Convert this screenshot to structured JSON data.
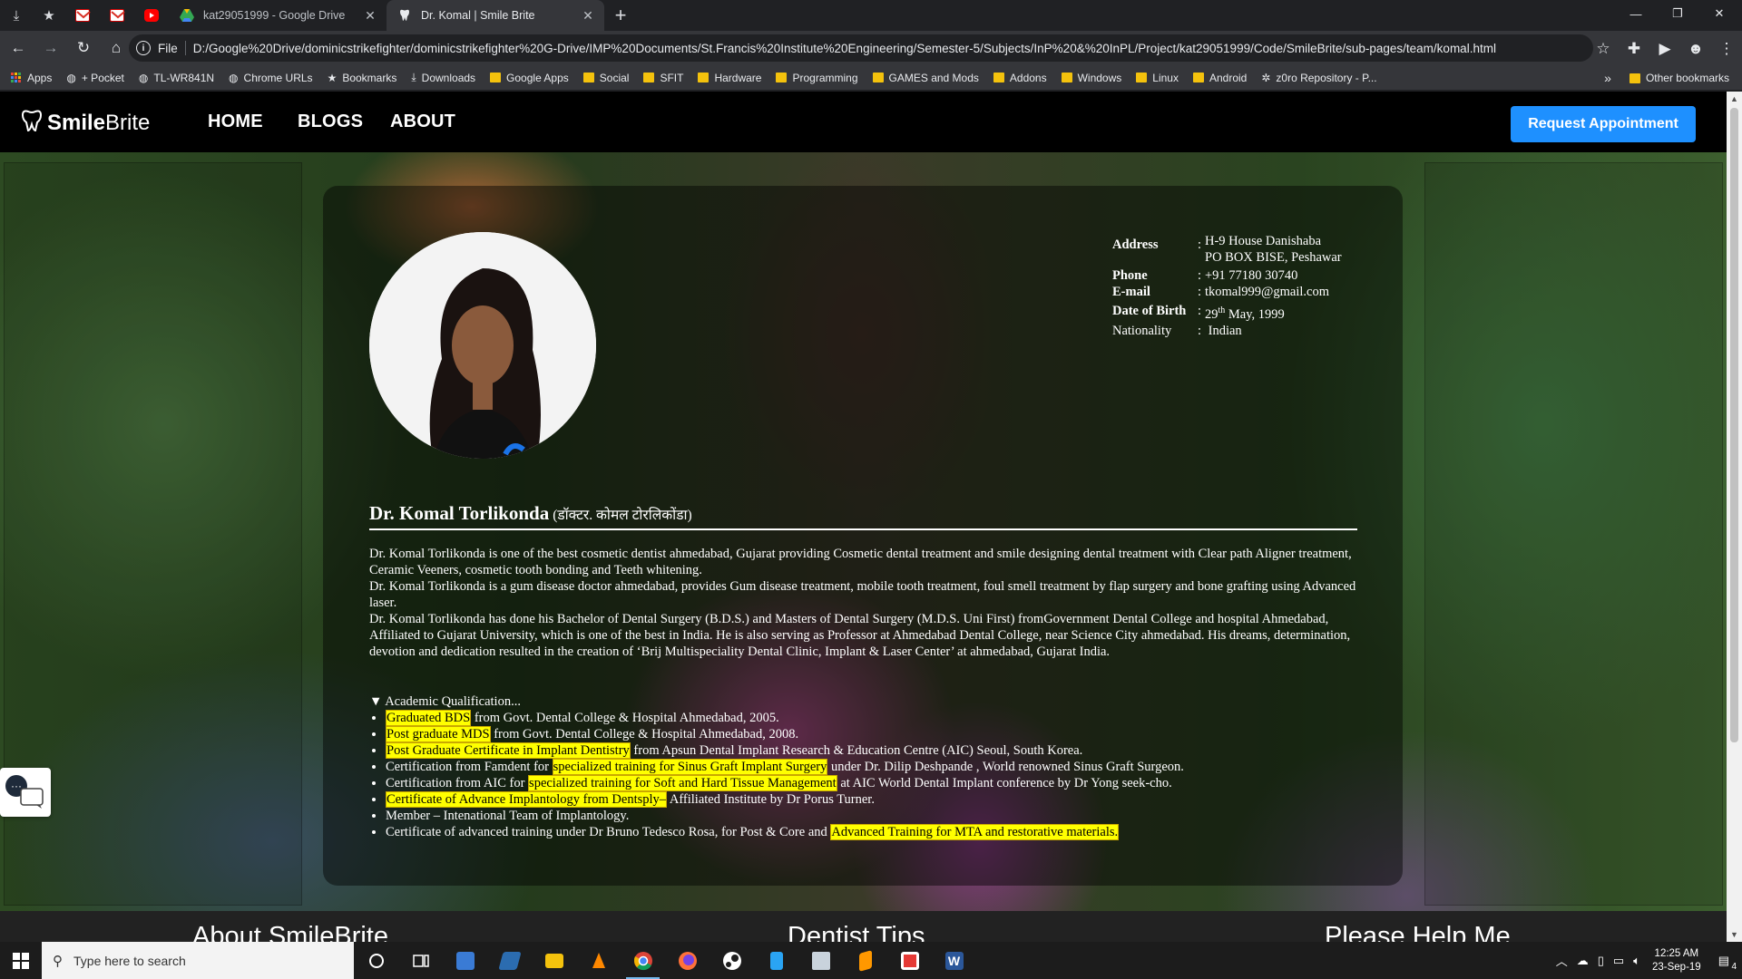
{
  "browser": {
    "tabs": [
      {
        "title": "kat29051999 - Google Drive",
        "favicon": "google-drive-icon",
        "active": false
      },
      {
        "title": "Dr. Komal | Smile Brite",
        "favicon": "tooth-icon",
        "active": true
      }
    ],
    "address": {
      "scheme": "File",
      "url": "D:/Google%20Drive/dominicstrikefighter/dominicstrikefighter%20G-Drive/IMP%20Documents/St.Francis%20Institute%20Engineering/Semester-5/Subjects/InP%20&%20InPL/Project/kat29051999/Code/SmileBrite/sub-pages/team/komal.html"
    },
    "bookmarks": [
      {
        "label": "Apps",
        "icon": "apps-grid-icon"
      },
      {
        "label": "+ Pocket",
        "icon": "globe-icon"
      },
      {
        "label": "TL-WR841N",
        "icon": "globe-icon"
      },
      {
        "label": "Chrome URLs",
        "icon": "globe-icon"
      },
      {
        "label": "Bookmarks",
        "icon": "star-icon"
      },
      {
        "label": "Downloads",
        "icon": "download-icon"
      },
      {
        "label": "Google Apps",
        "icon": "folder-icon"
      },
      {
        "label": "Social",
        "icon": "folder-icon"
      },
      {
        "label": "SFIT",
        "icon": "folder-icon"
      },
      {
        "label": "Hardware",
        "icon": "folder-icon"
      },
      {
        "label": "Programming",
        "icon": "folder-icon"
      },
      {
        "label": "GAMES and Mods",
        "icon": "folder-icon"
      },
      {
        "label": "Addons",
        "icon": "folder-icon"
      },
      {
        "label": "Windows",
        "icon": "folder-icon"
      },
      {
        "label": "Linux",
        "icon": "folder-icon"
      },
      {
        "label": "Android",
        "icon": "folder-icon"
      },
      {
        "label": "z0ro Repository - P...",
        "icon": "settings-icon"
      }
    ],
    "bookmarks_overflow": "»",
    "other_bookmarks": "Other bookmarks"
  },
  "site": {
    "logo": {
      "part1": "Smile",
      "part2": " Brite"
    },
    "nav": [
      "HOME",
      "BLOGS",
      "ABOUT"
    ],
    "cta": "Request Appointment"
  },
  "profile": {
    "contact": [
      {
        "key": "Address",
        "value_lines": [
          "H-9 House Danishaba",
          "PO BOX BISE, Peshawar"
        ]
      },
      {
        "key": "Phone",
        "value_lines": [
          "+91 77180 30740"
        ]
      },
      {
        "key": "E-mail",
        "value_lines": [
          "tkomal999@gmail.com"
        ]
      },
      {
        "key": "Date of Birth",
        "value_lines": [
          "29",
          "th",
          " May, 1999"
        ]
      },
      {
        "key": "Nationality",
        "value_lines": [
          "Indian"
        ]
      }
    ],
    "name": "Dr. Komal Torlikonda",
    "name_hindi": "(डॉक्टर. कोमल टोरलिकोंडा)",
    "bio": [
      "Dr. Komal Torlikonda is one of the best cosmetic dentist ahmedabad, Gujarat providing Cosmetic dental treatment and smile designing dental treatment with Clear path Aligner treatment, Ceramic Veeners, cosmetic tooth bonding and Teeth whitening.",
      "Dr. Komal Torlikonda is a gum disease doctor ahmedabad, provides Gum disease treatment, mobile tooth treatment, foul smell treatment by flap surgery and bone grafting using Advanced laser.",
      "Dr. Komal Torlikonda has done his Bachelor of Dental Surgery (B.D.S.) and Masters of Dental Surgery (M.D.S. Uni First) fromGovernment Dental College and hospital Ahmedabad, Affiliated to Gujarat University, which is one of the best in India. He is also serving as Professor at Ahmedabad Dental College, near Science City ahmedabad. His dreams, determination, devotion and dedication resulted in the creation of ‘Brij Multispeciality Dental Clinic, Implant & Laser Center’ at ahmedabad, Gujarat India."
    ],
    "academic_summary": "Academic Qualification...",
    "academic": [
      {
        "pre": "",
        "hl": "Graduated BDS",
        "post": " from Govt. Dental College & Hospital Ahmedabad, 2005."
      },
      {
        "pre": "",
        "hl": "Post graduate MDS",
        "post": " from Govt. Dental College & Hospital Ahmedabad, 2008."
      },
      {
        "pre": "",
        "hl": "Post Graduate Certificate in Implant Dentistry",
        "post": " from Apsun Dental Implant Research & Education Centre (AIC) Seoul, South Korea."
      },
      {
        "pre": "Certification from Famdent for ",
        "hl": "specialized training for Sinus Graft Implant Surgery",
        "post": " under Dr. Dilip Deshpande , World renowned Sinus Graft Surgeon."
      },
      {
        "pre": "Certification from AIC for ",
        "hl": "specialized training for Soft and Hard Tissue Management",
        "post": " at AIC World Dental Implant conference by Dr Yong seek-cho."
      },
      {
        "pre": "",
        "hl": "Certificate of Advance Implantology from Dentsply–",
        "post": " Affiliated Institute by Dr Porus Turner."
      },
      {
        "pre": "Member – Intenational Team of Implantology.",
        "hl": "",
        "post": ""
      },
      {
        "pre": "Certificate of advanced training under Dr Bruno Tedesco Rosa, for Post & Core and ",
        "hl": "Advanced Training for MTA and restorative materials.",
        "post": ""
      }
    ]
  },
  "footer": {
    "col1": "About SmileBrite",
    "col2": "Dentist Tips",
    "col3": "Please Help Me"
  },
  "taskbar": {
    "search_placeholder": "Type here to search",
    "time": "12:25 AM",
    "date": "23-Sep-19",
    "notifications": "4"
  },
  "colors": {
    "accent": "#1e90ff",
    "highlight": "#ffff00",
    "nav_bg": "#000000"
  }
}
